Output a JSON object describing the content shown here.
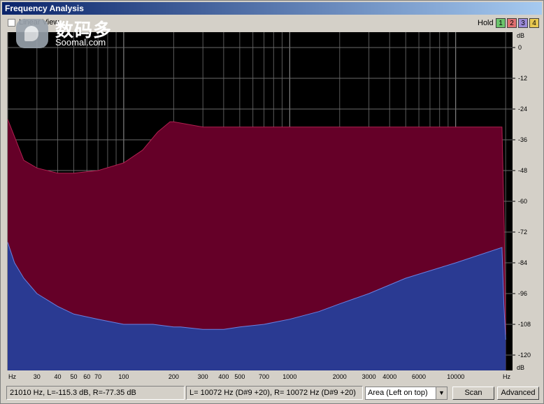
{
  "window": {
    "title": "Frequency Analysis"
  },
  "toolbar": {
    "linear_view_label": "Linear View",
    "linear_view_checked": false,
    "hold_label": "Hold",
    "hold_buttons": [
      {
        "label": "1",
        "color": "#6cc46c"
      },
      {
        "label": "2",
        "color": "#e07070"
      },
      {
        "label": "3",
        "color": "#9a8ad8"
      },
      {
        "label": "4",
        "color": "#e8c850"
      }
    ]
  },
  "watermark": {
    "chinese": "数码多",
    "latin": "Soomal.com"
  },
  "chart_data": {
    "type": "area",
    "x_scale": "log",
    "xlim": [
      20,
      22000
    ],
    "ylim": [
      -126,
      6
    ],
    "x_unit": "Hz",
    "y_unit": "dB",
    "x_ticks": [
      {
        "value": 30,
        "label": "30"
      },
      {
        "value": 40,
        "label": "40"
      },
      {
        "value": 50,
        "label": "50"
      },
      {
        "value": 60,
        "label": "60"
      },
      {
        "value": 70,
        "label": "70"
      },
      {
        "value": 100,
        "label": "100"
      },
      {
        "value": 200,
        "label": "200"
      },
      {
        "value": 300,
        "label": "300"
      },
      {
        "value": 400,
        "label": "400"
      },
      {
        "value": 500,
        "label": "500"
      },
      {
        "value": 700,
        "label": "700"
      },
      {
        "value": 1000,
        "label": "1000"
      },
      {
        "value": 2000,
        "label": "2000"
      },
      {
        "value": 3000,
        "label": "3000"
      },
      {
        "value": 4000,
        "label": "4000"
      },
      {
        "value": 6000,
        "label": "6000"
      },
      {
        "value": 10000,
        "label": "10000"
      }
    ],
    "y_ticks": [
      0,
      -12,
      -24,
      -36,
      -48,
      -60,
      -72,
      -84,
      -96,
      -108,
      -120
    ],
    "grid": true,
    "series": [
      {
        "color": "#650028",
        "x": [
          20,
          23,
          25,
          30,
          40,
          50,
          70,
          100,
          130,
          160,
          190,
          200,
          300,
          500,
          1000,
          2000,
          5000,
          10000,
          19000,
          19600,
          20000
        ],
        "y": [
          -28,
          -38,
          -44,
          -47,
          -49,
          -49,
          -48,
          -45,
          -40,
          -33,
          -29,
          -29,
          -31,
          -31,
          -31,
          -31,
          -31,
          -31,
          -31,
          -70,
          -112
        ]
      },
      {
        "color": "#2a3a92",
        "x": [
          20,
          22,
          25,
          30,
          40,
          50,
          70,
          100,
          150,
          200,
          220,
          300,
          400,
          500,
          700,
          1000,
          1500,
          2000,
          3000,
          5000,
          10000,
          19000,
          19500,
          20000
        ],
        "y": [
          -76,
          -84,
          -90,
          -96,
          -101,
          -104,
          -106,
          -108,
          -108,
          -109,
          -109,
          -110,
          -110,
          -109,
          -108,
          -106,
          -103,
          -100,
          -96,
          -90,
          -84,
          -78,
          -100,
          -114
        ]
      }
    ]
  },
  "status": {
    "cursor": "21010 Hz, L=-115.3 dB, R=-77.35 dB",
    "peak": "L=  10072 Hz (D#9 +20), R=  10072 Hz (D#9 +20)"
  },
  "controls": {
    "view_mode": "Area (Left on top)",
    "scan_label": "Scan",
    "advanced_label": "Advanced"
  }
}
